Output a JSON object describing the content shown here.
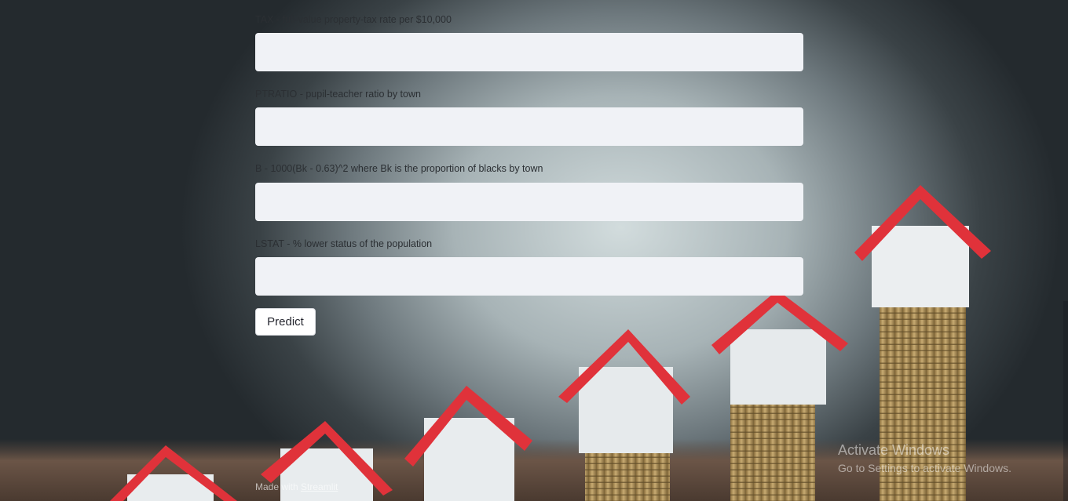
{
  "form": {
    "fields": [
      {
        "label": "TAX - full-value property-tax rate per $10,000",
        "value": ""
      },
      {
        "label": "PTRATIO - pupil-teacher ratio by town",
        "value": ""
      },
      {
        "label": "B - 1000(Bk - 0.63)^2 where Bk is the proportion of blacks by town",
        "value": ""
      },
      {
        "label": "LSTAT - % lower status of the population",
        "value": ""
      }
    ],
    "predict_label": "Predict"
  },
  "footer": {
    "prefix": "Made with",
    "link": "Streamlit"
  },
  "windows_activation": {
    "title": "Activate Windows",
    "subtitle": "Go to Settings to activate Windows."
  },
  "colors": {
    "roof": "#e0323a",
    "house_wall": "#eceff1",
    "coin": "#b89a5e",
    "input_bg": "#f0f2f6"
  }
}
